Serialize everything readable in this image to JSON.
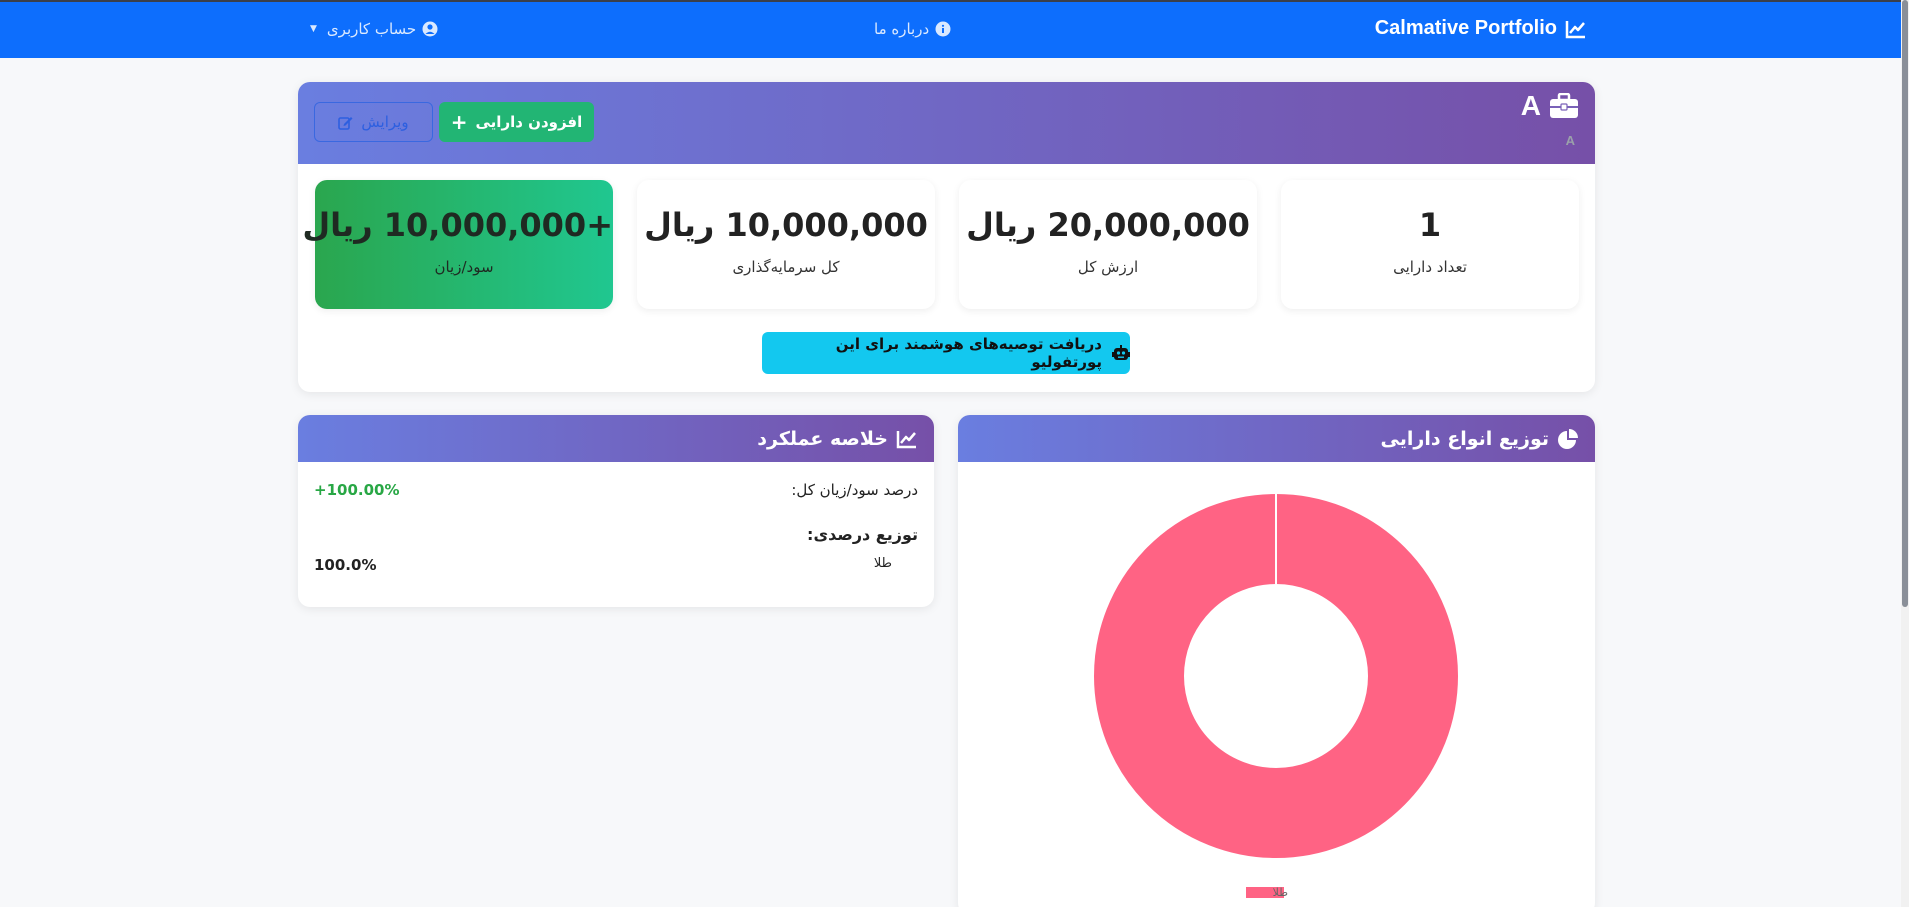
{
  "navbar": {
    "brand": "Calmative Portfolio",
    "about": "درباره ما",
    "account": "حساب کاربری"
  },
  "portfolio": {
    "name": "A",
    "description": "A",
    "add_asset_label": "افزودن دارایی",
    "edit_label": "ویرایش",
    "stats": {
      "asset_count": {
        "value": "1",
        "label": "تعداد دارایی"
      },
      "total_value": {
        "value": "20,000,000 ریال",
        "label": "ارزش کل"
      },
      "total_investment": {
        "value": "10,000,000 ریال",
        "label": "کل سرمایه‌گذاری"
      },
      "profit_loss": {
        "value": "+10,000,000 ریال",
        "label": "سود/زیان"
      }
    },
    "ai_button_label": "دریافت توصیه‌های هوشمند برای این پورتفولیو"
  },
  "distribution": {
    "title": "توزیع انواع دارایی"
  },
  "summary": {
    "title": "خلاصه عملکرد",
    "total_pl_label": "درصد سود/زیان کل:",
    "total_pl_value": "+100.00%",
    "distribution_title": "توزیع درصدی:",
    "items": [
      {
        "name": "طلا",
        "percent": "100.0%"
      }
    ]
  },
  "chart_data": {
    "type": "pie",
    "variant": "doughnut",
    "categories": [
      "طلا"
    ],
    "values": [
      100
    ],
    "colors": [
      "#ff6384"
    ],
    "legend_position": "bottom"
  },
  "colors": {
    "navbar": "#0d6efd",
    "header_gradient_start": "#6a7ee0",
    "header_gradient_end": "#7650a8",
    "success": "#22b574",
    "info": "#13c8ef"
  }
}
